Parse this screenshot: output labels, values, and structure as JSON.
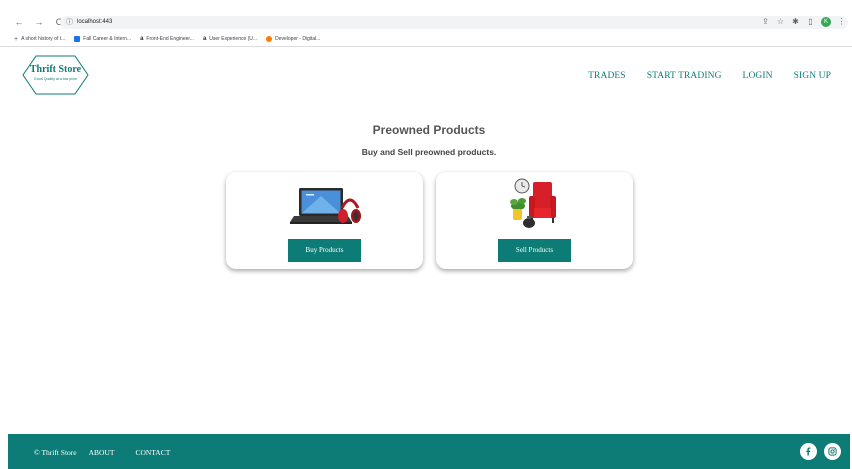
{
  "browser": {
    "url": "localhost:443",
    "bookmarks": [
      {
        "label": "A short history of t...",
        "color": "#777777"
      },
      {
        "label": "Fall Career & Intern...",
        "color": "#1a73e8"
      },
      {
        "label": "Front-End Engineer...",
        "color": "#232f3e"
      },
      {
        "label": "User Experience (U...",
        "color": "#232f3e"
      },
      {
        "label": "Developer - Digital...",
        "color": "#ff7a00"
      }
    ],
    "profile_initial": "K"
  },
  "brand": {
    "name": "Thrift Store",
    "tagline": "Good Quality at a low price",
    "accent": "#0d7b76"
  },
  "nav": {
    "items": [
      "TRADES",
      "START TRADING",
      "LOGIN",
      "SIGN UP"
    ]
  },
  "hero": {
    "title": "Preowned Products",
    "subtitle": "Buy and Sell preowned products."
  },
  "cards": {
    "buy": {
      "button": "Buy Products",
      "image": "laptop-headphones"
    },
    "sell": {
      "button": "Sell Products",
      "image": "armchair-clock-plant"
    }
  },
  "footer": {
    "copyright": "© Thrift Store",
    "about": "ABOUT",
    "contact": "CONTACT",
    "socials": [
      "facebook-icon",
      "instagram-icon"
    ]
  }
}
